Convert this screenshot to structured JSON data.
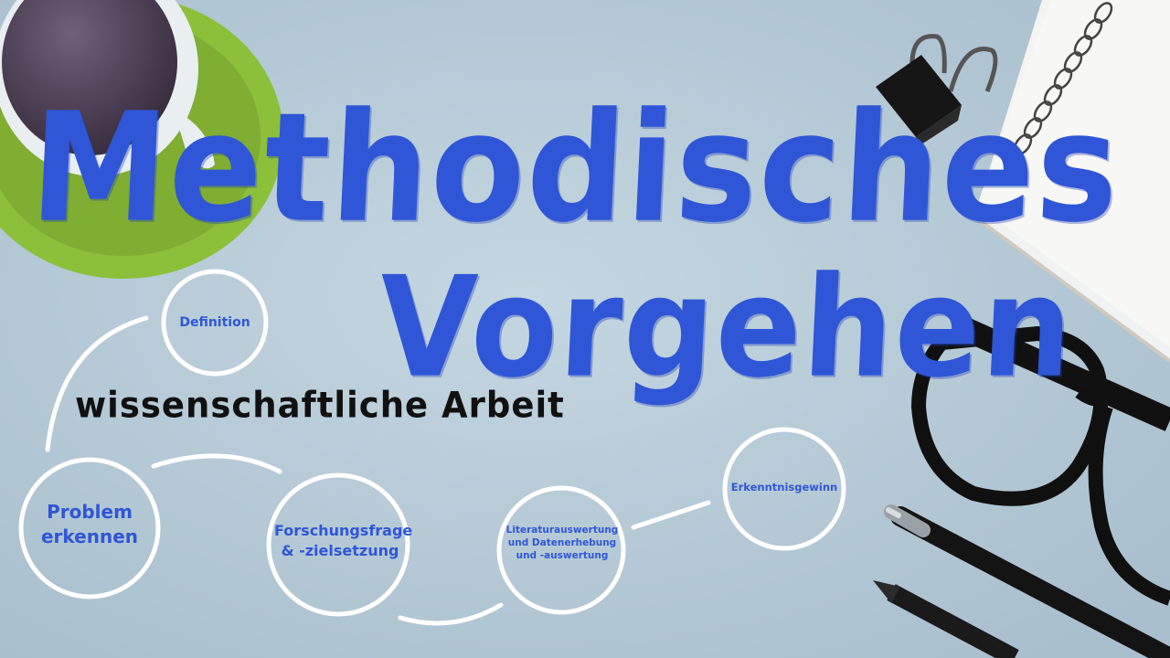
{
  "title": {
    "line1": "Methodisches",
    "line2": "Vorgehen",
    "subtitle": "wissenschaftliche Arbeit"
  },
  "nodes": {
    "definition": "Definition",
    "problem": "Problem\nerkennen",
    "forschungsfrage": "Forschungsfrage\n&  -zielsetzung",
    "literatur": "Literaturauswertung\nund  Datenerhebung\nund -auswertung",
    "erkenntnis": "Erkenntnisgewinn"
  },
  "colors": {
    "background": "#b9ccd8",
    "title_blue": "#2f56d6",
    "saucer_green": "#8cbf3a",
    "node_stroke": "#ffffff",
    "subtitle_black": "#111111"
  },
  "icons": [
    "coffee-cup",
    "saucer",
    "binder-clip",
    "spiral-notebook",
    "glasses",
    "pen",
    "pencil"
  ]
}
